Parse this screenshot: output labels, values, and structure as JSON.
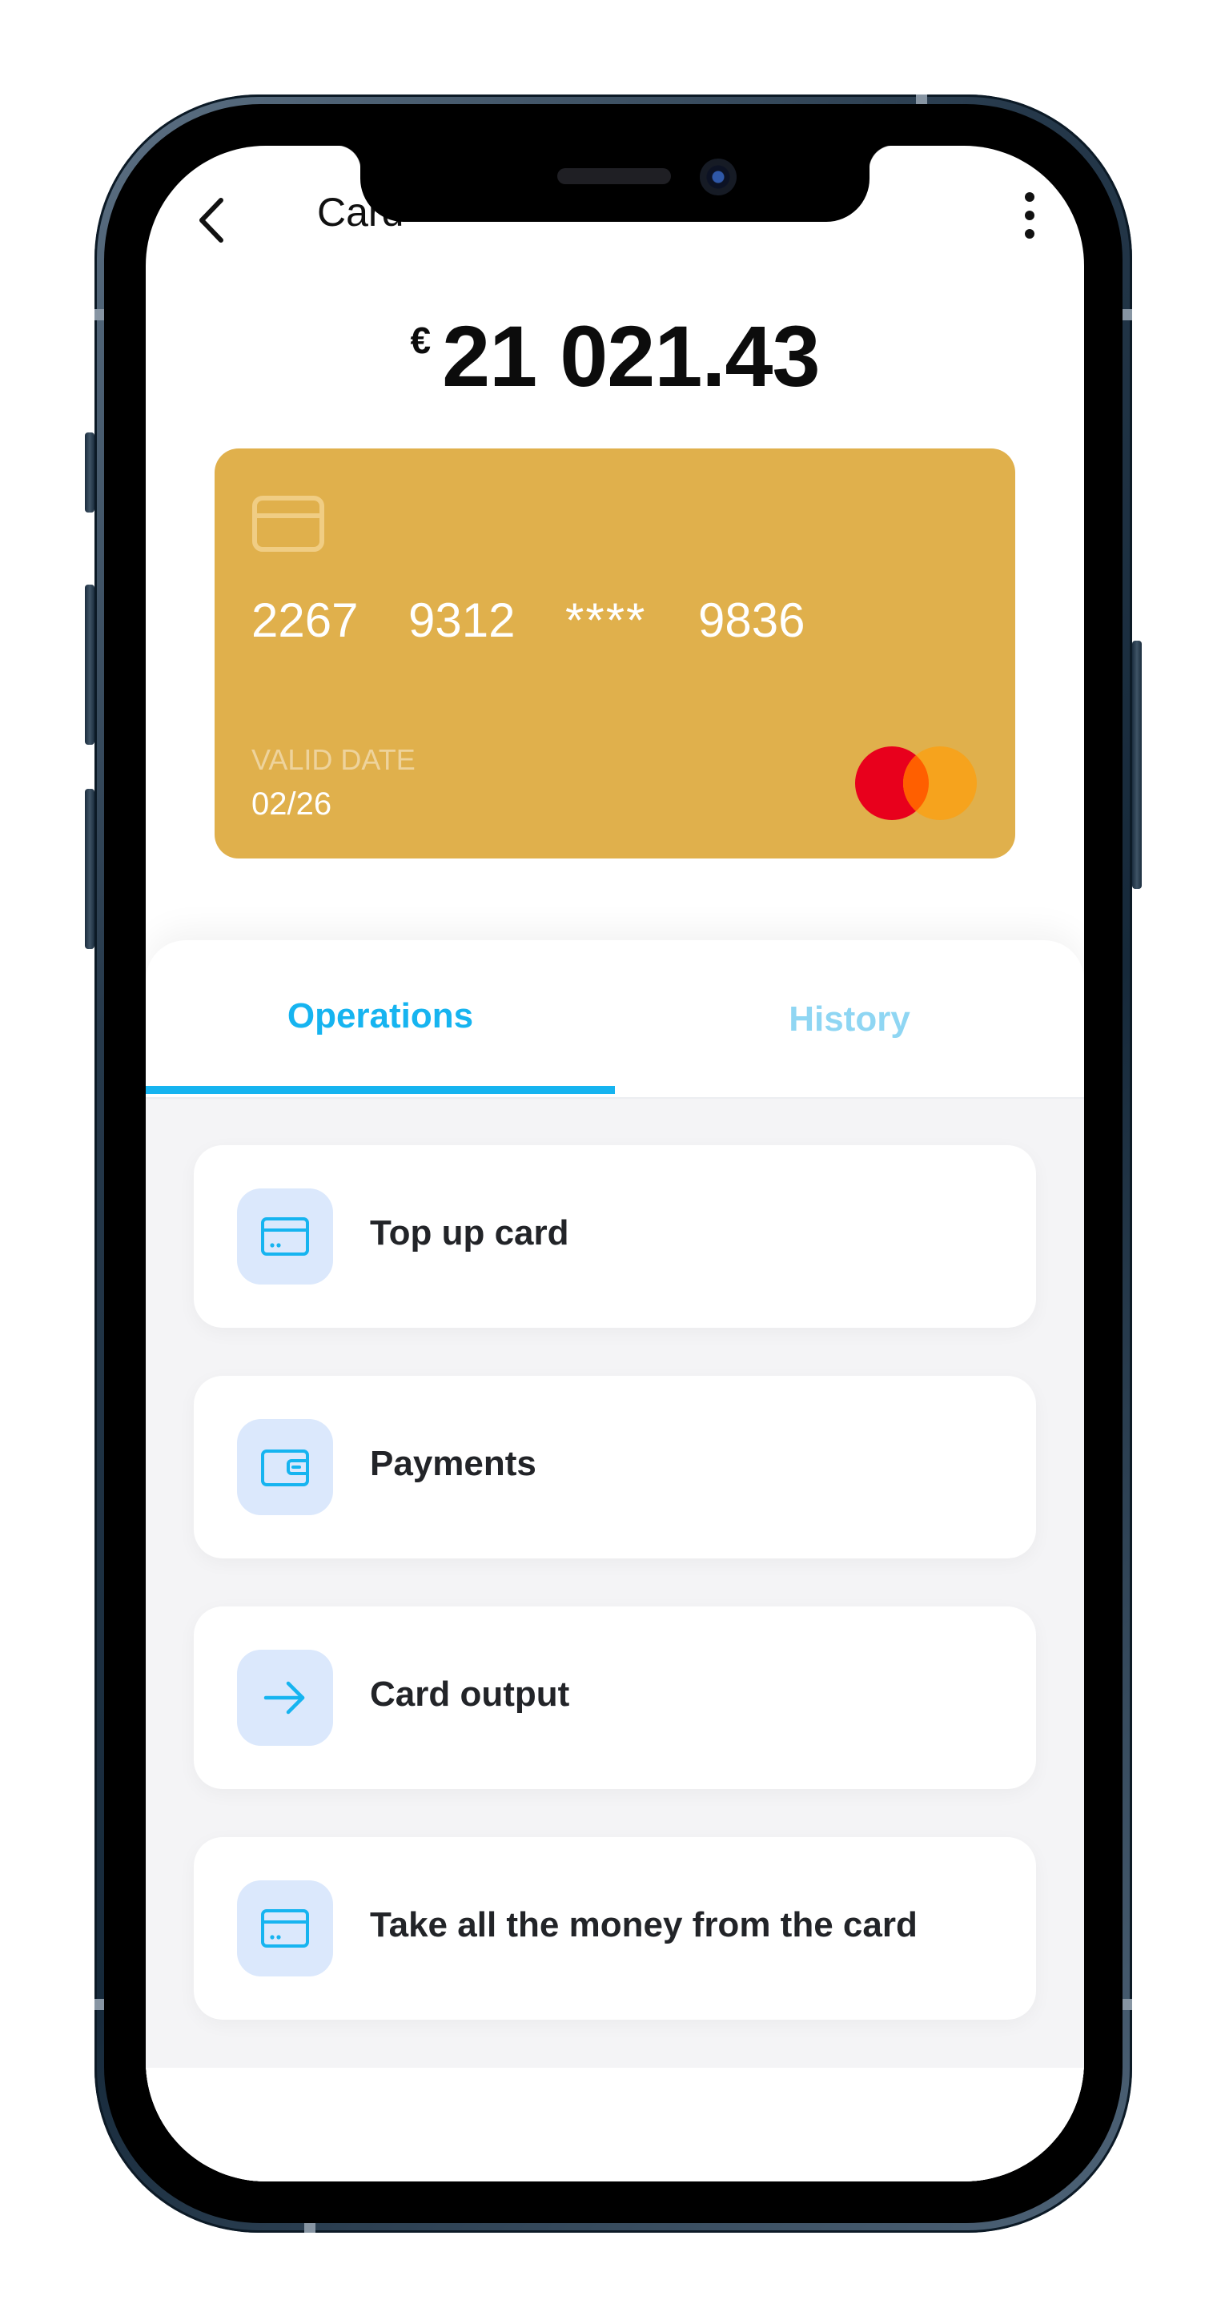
{
  "header": {
    "title": "Card",
    "back_icon": "chevron-left-icon",
    "menu_icon": "more-vertical-icon"
  },
  "balance": {
    "currency": "€",
    "amount": "21 021.43"
  },
  "card": {
    "color": "#e0b04c",
    "number_groups": [
      "2267",
      "9312",
      "****",
      "9836"
    ],
    "valid_label": "VALID DATE",
    "valid_value": "02/26",
    "brand_icon": "mastercard-logo"
  },
  "tabs": [
    {
      "label": "Operations",
      "active": true
    },
    {
      "label": "History",
      "active": false
    }
  ],
  "operations": [
    {
      "label": "Top up card",
      "icon": "credit-card-icon"
    },
    {
      "label": "Payments",
      "icon": "wallet-icon"
    },
    {
      "label": "Card output",
      "icon": "arrow-right-icon"
    },
    {
      "label": "Take all the money from the card",
      "icon": "credit-card-icon"
    }
  ],
  "colors": {
    "accent": "#16b4f0",
    "accent_light": "#8fd6f3",
    "icon_bg": "#dbe8fc"
  }
}
